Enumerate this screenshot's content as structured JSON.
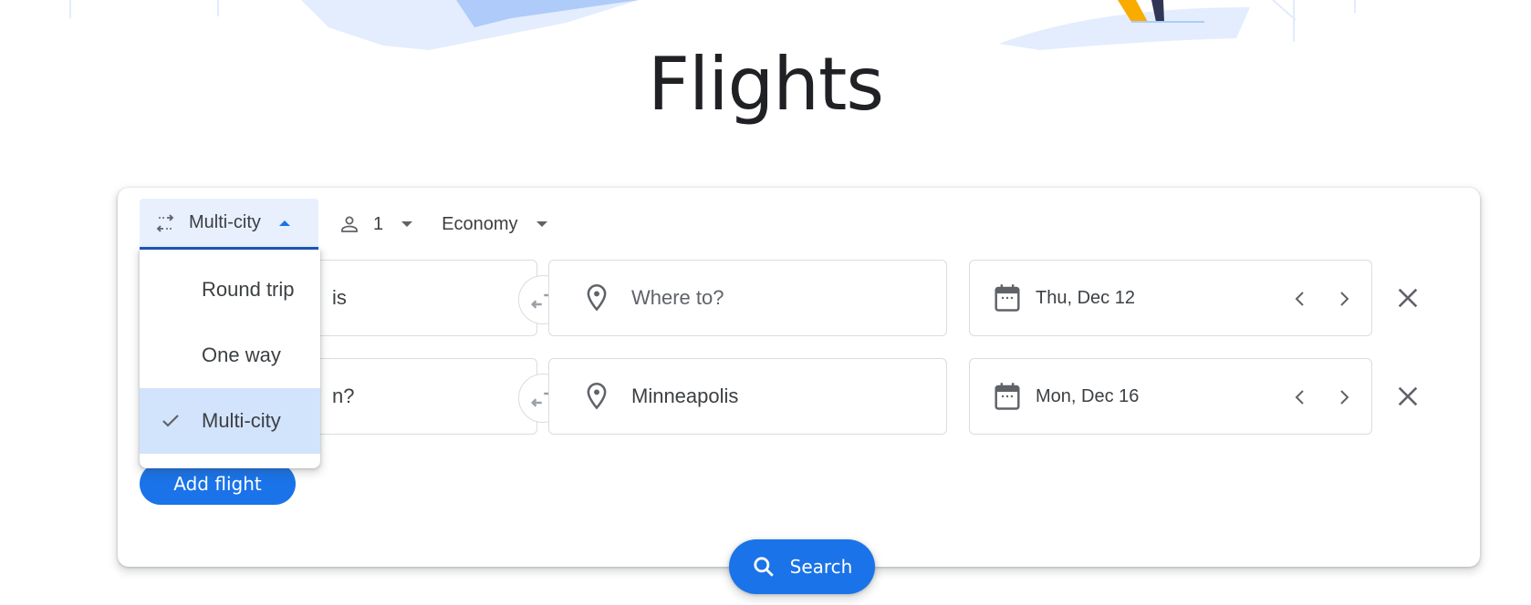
{
  "page": {
    "title": "Flights"
  },
  "toolbar": {
    "trip_type": {
      "label": "Multi-city",
      "icon": "multi-city-arrows-icon",
      "expanded": true
    },
    "passengers": {
      "count": "1",
      "icon": "person-icon"
    },
    "cabin_class": {
      "label": "Economy"
    }
  },
  "trip_type_menu": {
    "options": [
      {
        "label": "Round trip",
        "selected": false
      },
      {
        "label": "One way",
        "selected": false
      },
      {
        "label": "Multi-city",
        "selected": true
      }
    ]
  },
  "legs": [
    {
      "from": {
        "visible_text": "is"
      },
      "to": {
        "value": "",
        "placeholder": "Where to?"
      },
      "date": "Thu, Dec 12"
    },
    {
      "from": {
        "visible_text": "n?"
      },
      "to": {
        "value": "Minneapolis",
        "placeholder": "Where to?"
      },
      "date": "Mon, Dec 16"
    }
  ],
  "buttons": {
    "add_flight": "Add flight",
    "search": "Search"
  },
  "colors": {
    "accent": "#1a73e8",
    "selected_menu_bg": "#d2e3fc",
    "trip_button_bg": "#e8f0fe",
    "text": "#3c4043",
    "border": "#dadce0"
  }
}
